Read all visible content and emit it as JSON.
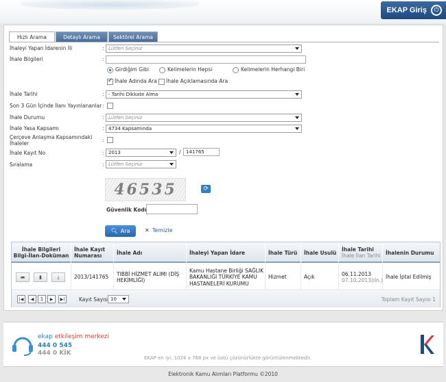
{
  "header": {
    "login_label": "EKAP Giriş",
    "login_icon": "power-icon"
  },
  "tabs": [
    {
      "label": "Hızlı Arama",
      "active": true
    },
    {
      "label": "Detaylı Arama",
      "active": false
    },
    {
      "label": "Sektörel Arama",
      "active": false
    }
  ],
  "form": {
    "il": {
      "label": "İhaleyi Yapan İdarenin İli",
      "value": "Lütfen Seçiniz"
    },
    "bilgi": {
      "label": "İhale Bilgileri",
      "value": ""
    },
    "match_options": [
      "Girdiğim Gibi",
      "Kelimelerin Hepsi",
      "Kelimelerin Herhangi Biri"
    ],
    "match_selected": "Girdiğim Gibi",
    "search_in": [
      {
        "label": "İhale Adında Ara",
        "checked": true
      },
      {
        "label": "İhale Açıklamasında Ara",
        "checked": false
      }
    ],
    "tarih": {
      "label": "İhale Tarihi",
      "value": "- Tarihi Dikkate Alma"
    },
    "son3": {
      "label": "Son 3 Gün İçinde İlanı Yayınlananlar",
      "checked": false
    },
    "durum": {
      "label": "İhale Durumu",
      "value": "Lütfen Seçiniz"
    },
    "kapsam": {
      "label": "İhale Yasa Kapsamı",
      "value": "4734 Kapsamında"
    },
    "cerceve": {
      "label_line1": "Çerçeve Anlaşma Kapsamındaki",
      "label_line2": "İhaleler",
      "checked": false
    },
    "kayit": {
      "label": "İhale Kayıt No",
      "year": "2013",
      "separator": "/",
      "number": "141765"
    },
    "siralama": {
      "label": "Sıralama",
      "value": "Lütfen Seçiniz"
    },
    "colon": ":"
  },
  "captcha": {
    "text": "46535",
    "label": "Güvenlik Kodu",
    "value": ""
  },
  "actions": {
    "search_label": "Ara",
    "clear_label": "Temizle"
  },
  "table": {
    "headers": [
      {
        "main": "İhale Bilgileri",
        "sub": "Bilgi-İlan-Doküman"
      },
      {
        "main": "İhale Kayıt",
        "sub": "Numarası"
      },
      {
        "main": "İhale Adı",
        "sub": ""
      },
      {
        "main": "İhaleyi Yapan İdare",
        "sub": ""
      },
      {
        "main": "İhale Türü",
        "sub": ""
      },
      {
        "main": "İhale Usulü",
        "sub": ""
      },
      {
        "main": "İhale Tarihi",
        "sub": "İhale İlan Tarihi"
      },
      {
        "main": "İhalenin Durumu",
        "sub": ""
      }
    ],
    "rows": [
      {
        "kayit_no": "2013/141765",
        "ad_line1": "TIBBİ HİZMET ALIMI (DİŞ",
        "ad_line2": "HEKİMLİĞİ)",
        "idare_line1": "Kamu Hastane Birliği SAĞLIK",
        "idare_line2": "BAKANLIĞI TÜRKİYE KAMU",
        "idare_line3": "HASTANELERİ KURUMU",
        "tur": "Hizmet",
        "usul": "Açık",
        "tarih": "06.11.2013",
        "ilan_tarih": "07.10.2013(iln.)",
        "durum": "İhale İptal Edilmiş"
      }
    ],
    "pager": {
      "current_page": "1",
      "page_size_label": "Kayıt Sayısı",
      "page_size": "10",
      "total": "Toplam Kayıt Sayısı 1"
    }
  },
  "footer": {
    "brand_part1": "ekap",
    "brand_part2": "etkileşim merkezi",
    "phone1": "444 0 545",
    "phone2": "444 0 KİK",
    "note": "EKAP en iyi, 1024 x 768 px ve üstü çözünürlükte görüntülenmektedir.",
    "copyright": "Elektronik Kamu Alımları Platformu ©2010"
  },
  "colors": {
    "accent": "#2f6db0",
    "brand_red": "#d33c3c"
  }
}
